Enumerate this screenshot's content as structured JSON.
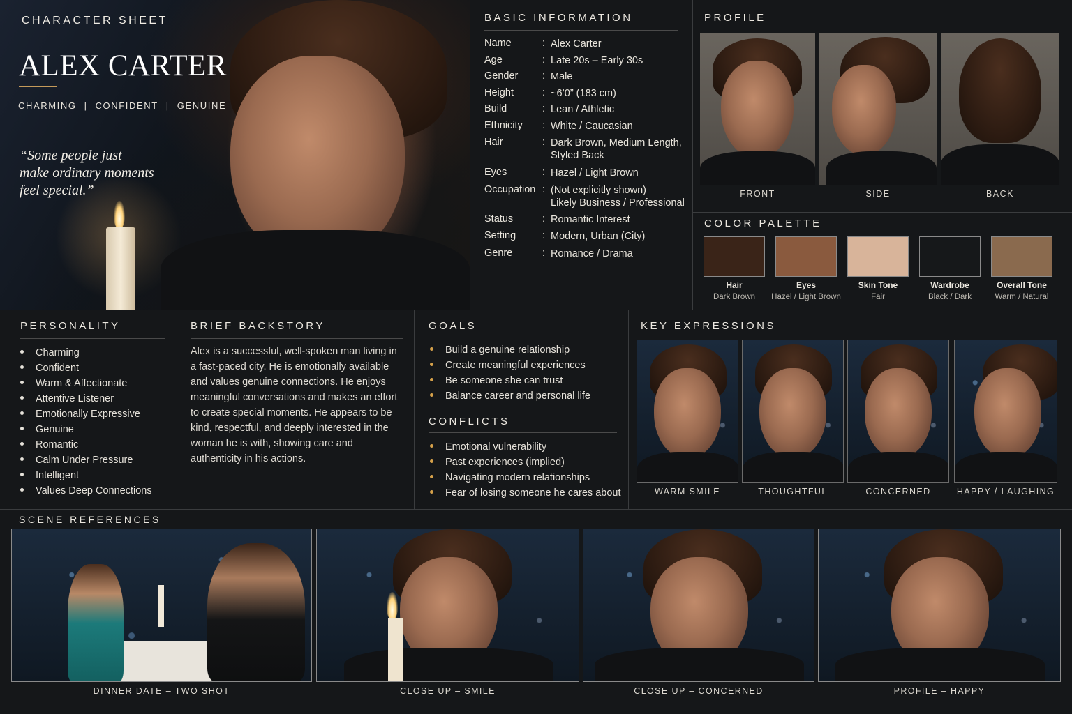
{
  "hero": {
    "kicker": "CHARACTER SHEET",
    "name": "ALEX CARTER",
    "traits": [
      "CHARMING",
      "CONFIDENT",
      "GENUINE"
    ],
    "separator": "|",
    "quote_lines": [
      "“Some people just",
      "make ordinary moments",
      "feel special.”"
    ]
  },
  "basic_info": {
    "title": "BASIC INFORMATION",
    "colon": ":",
    "rows": [
      {
        "label": "Name",
        "value": "Alex Carter"
      },
      {
        "label": "Age",
        "value": "Late 20s – Early 30s"
      },
      {
        "label": "Gender",
        "value": "Male"
      },
      {
        "label": "Height",
        "value": "~6’0” (183 cm)"
      },
      {
        "label": "Build",
        "value": "Lean / Athletic"
      },
      {
        "label": "Ethnicity",
        "value": "White / Caucasian"
      },
      {
        "label": "Hair",
        "value": "Dark Brown, Medium Length,",
        "value2": "Styled Back"
      },
      {
        "label": "Eyes",
        "value": "Hazel / Light Brown"
      },
      {
        "label": "Occupation",
        "value": "(Not explicitly shown)",
        "value2": "Likely Business / Professional"
      },
      {
        "label": "Status",
        "value": "Romantic Interest"
      },
      {
        "label": "Setting",
        "value": "Modern, Urban (City)"
      },
      {
        "label": "Genre",
        "value": "Romance / Drama"
      }
    ]
  },
  "profile": {
    "title": "PROFILE",
    "views": [
      "FRONT",
      "SIDE",
      "BACK"
    ]
  },
  "palette": {
    "title": "COLOR PALETTE",
    "swatches": [
      {
        "name": "Hair",
        "value": "Dark Brown",
        "color": "#3a2418"
      },
      {
        "name": "Eyes",
        "value": "Hazel / Light Brown",
        "color": "#8a5a3e"
      },
      {
        "name": "Skin Tone",
        "value": "Fair",
        "color": "#d8b49a"
      },
      {
        "name": "Wardrobe",
        "value": "Black / Dark",
        "color": "#16181a"
      },
      {
        "name": "Overall Tone",
        "value": "Warm / Natural",
        "color": "#8a6a4e"
      }
    ]
  },
  "personality": {
    "title": "PERSONALITY",
    "items": [
      "Charming",
      "Confident",
      "Warm & Affectionate",
      "Attentive Listener",
      "Emotionally Expressive",
      "Genuine",
      "Romantic",
      "Calm Under Pressure",
      "Intelligent",
      "Values Deep Connections"
    ]
  },
  "backstory": {
    "title": "BRIEF BACKSTORY",
    "lines": [
      "Alex is a successful, well-spoken man living in",
      "a fast-paced city. He is emotionally available",
      "and values genuine connections. He enjoys",
      "meaningful conversations and makes an effort",
      "to create special moments. He appears to be",
      "kind, respectful, and deeply interested in the",
      "woman he is with, showing care and",
      "authenticity in his actions."
    ]
  },
  "goals": {
    "title": "GOALS",
    "items": [
      "Build a genuine relationship",
      "Create meaningful experiences",
      "Be someone she can trust",
      "Balance career and personal life"
    ]
  },
  "conflicts": {
    "title": "CONFLICTS",
    "items": [
      "Emotional vulnerability",
      "Past experiences (implied)",
      "Navigating modern relationships",
      "Fear of losing someone he cares about"
    ]
  },
  "expressions": {
    "title": "KEY EXPRESSIONS",
    "items": [
      "WARM SMILE",
      "THOUGHTFUL",
      "CONCERNED",
      "HAPPY / LAUGHING"
    ]
  },
  "scenes": {
    "title": "SCENE REFERENCES",
    "items": [
      "DINNER DATE – TWO SHOT",
      "CLOSE UP – SMILE",
      "CLOSE UP – CONCERNED",
      "PROFILE – HAPPY"
    ]
  }
}
